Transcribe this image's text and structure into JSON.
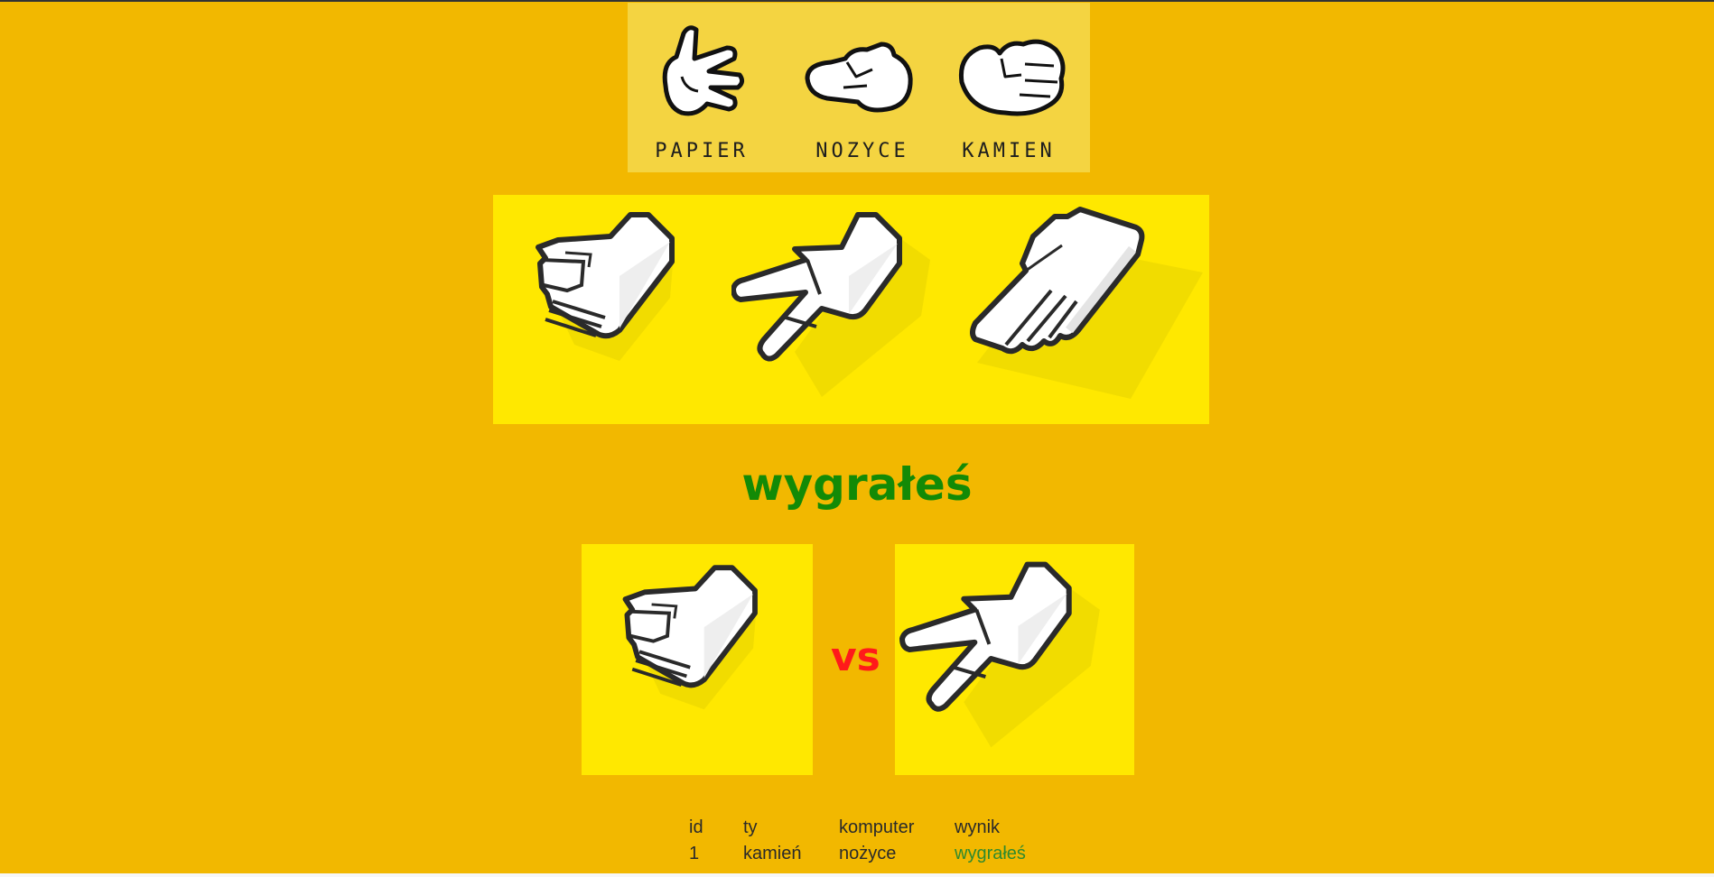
{
  "logo": {
    "labels": [
      "PAPIER",
      "NOZYCE",
      "KAMIEN"
    ],
    "icons": [
      "paper-glove-icon",
      "scissors-glove-icon",
      "rock-glove-icon"
    ]
  },
  "choices": [
    {
      "name": "kamień",
      "icon": "rock-hand-icon"
    },
    {
      "name": "nożyce",
      "icon": "scissors-hand-icon"
    },
    {
      "name": "papier",
      "icon": "paper-hand-icon"
    }
  ],
  "result": {
    "text": "wygrałeś",
    "color": "#138a06"
  },
  "battle": {
    "player_icon": "rock-hand-icon",
    "vs": "vs",
    "computer_icon": "scissors-hand-icon",
    "vs_color": "#ff1a1a"
  },
  "history": {
    "headers": [
      "id",
      "ty",
      "komputer",
      "wynik"
    ],
    "rows": [
      [
        "1",
        "kamień",
        "nożyce",
        "wygrałeś"
      ]
    ]
  },
  "colors": {
    "background": "#f2b800",
    "panel": "#ffe800",
    "logo_panel": "#f4d441"
  }
}
